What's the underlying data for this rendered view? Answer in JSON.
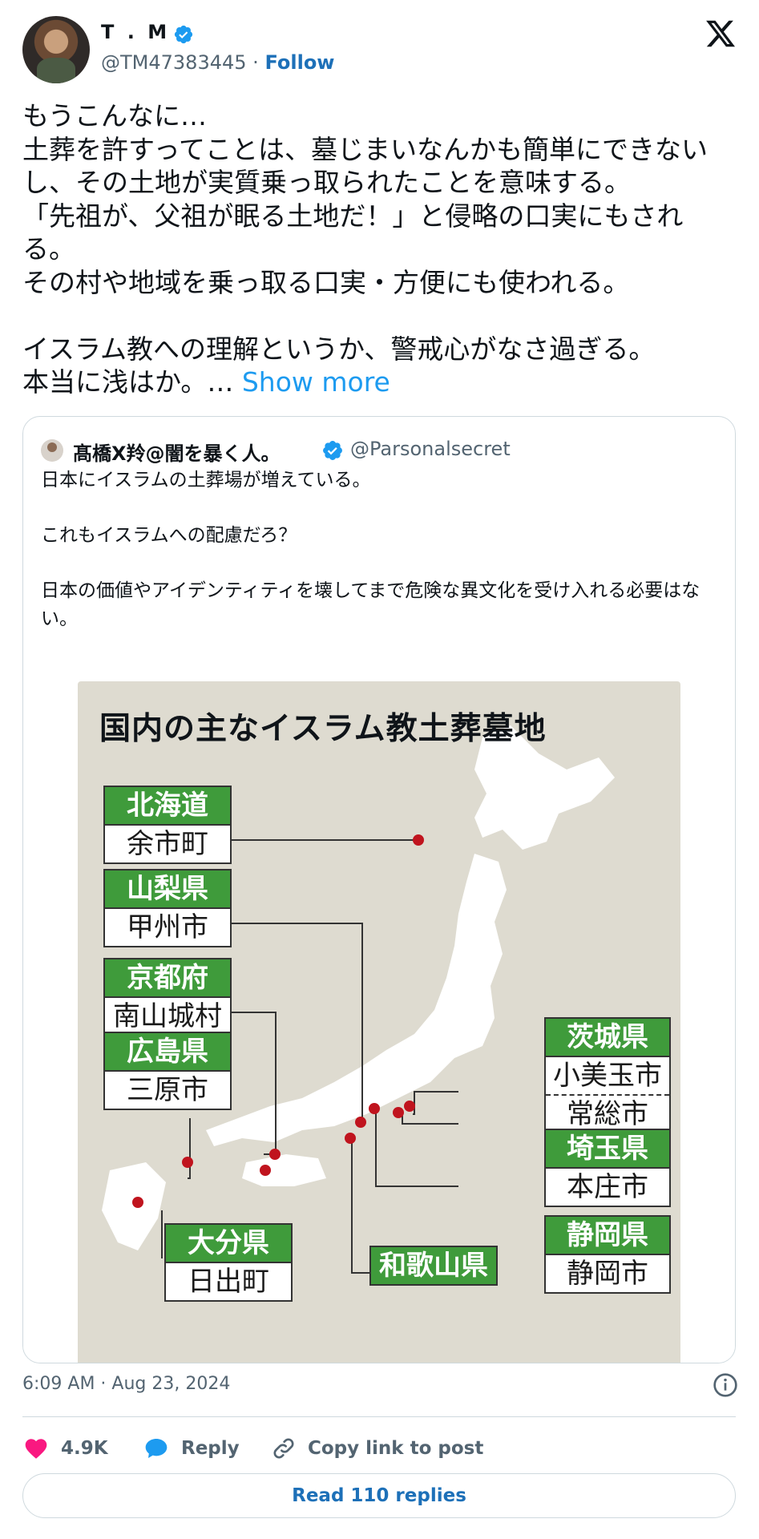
{
  "author": {
    "name": "T . M",
    "handle": "@TM47383445",
    "separator": "·",
    "follow_label": "Follow",
    "verified": true
  },
  "tweet": {
    "text": "もうこんなに…\n土葬を許すってことは、墓じまいなんかも簡単にできないし、その土地が実質乗っ取られたことを意味する。\n「先祖が、父祖が眠る土地だ！」と侵略の口実にもされる。\nその村や地域を乗っ取る口実・方便にも使われる。\n\nイスラム教への理解というか、警戒心がなさ過ぎる。\n本当に浅はか。… ",
    "show_more": "Show more"
  },
  "quote": {
    "name": "髙橋X羚@闇を暴く人。",
    "handle": "@Parsonalsecret",
    "text": "日本にイスラムの土葬場が増えている。\n\nこれもイスラムへの配慮だろ？\n\n日本の価値やアイデンティティを壊してまで危険な異文化を受け入れる必要はない。",
    "map": {
      "title": "国内の主なイスラム教土葬墓地",
      "labels": [
        {
          "pref": "北海道",
          "city": "余市町"
        },
        {
          "pref": "山梨県",
          "city": "甲州市"
        },
        {
          "pref": "京都府",
          "city": "南山城村"
        },
        {
          "pref": "広島県",
          "city": "三原市"
        },
        {
          "pref": "大分県",
          "city": "日出町"
        },
        {
          "pref": "茨城県",
          "city": "小美玉市",
          "city2": "常総市"
        },
        {
          "pref": "埼玉県",
          "city": "本庄市"
        },
        {
          "pref": "静岡県",
          "city": "静岡市"
        },
        {
          "pref": "和歌山県",
          "city": ""
        }
      ],
      "colors": {
        "pref_bg": "#3f9b3b",
        "map_bg": "#dedbd0",
        "dot": "#c0141e"
      }
    }
  },
  "meta": {
    "timestamp": "6:09 AM · Aug 23, 2024"
  },
  "actions": {
    "likes": "4.9K",
    "reply_label": "Reply",
    "copy_label": "Copy link to post",
    "read_replies": "Read 110 replies"
  },
  "icons": [
    "verified-badge-icon",
    "x-logo-icon",
    "info-icon",
    "heart-icon",
    "reply-bubble-icon",
    "link-icon"
  ]
}
